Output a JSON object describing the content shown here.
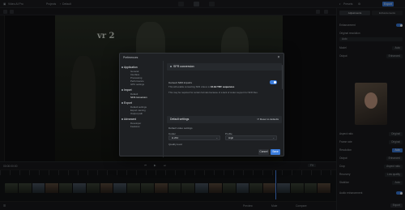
{
  "app": {
    "title": "Video AI Pro",
    "breadcrumb_project": "Projects",
    "breadcrumb_current": "Default"
  },
  "right_header": {
    "presets_label": "Presets",
    "export_label": "Export"
  },
  "right_panel": {
    "tabs": [
      "Adjustments",
      "Enhancements"
    ],
    "rows": [
      {
        "label": "Enhancement",
        "value": ""
      },
      {
        "label": "Original resolution",
        "value": "Auto"
      },
      {
        "label": "Model",
        "value": "Auto"
      },
      {
        "label": "Output",
        "value": "Enhanced"
      }
    ],
    "bottom_rows": [
      {
        "label": "Aspect ratio",
        "value": "Original"
      },
      {
        "label": "Frame rate",
        "value": "Original"
      },
      {
        "label": "Resolution",
        "value": "Auto"
      },
      {
        "label": "Output",
        "value": "Enhanced"
      },
      {
        "label": "Crop",
        "value": "Aspect ratio"
      },
      {
        "label": "Recovery",
        "value": "Low quality"
      },
      {
        "label": "Stabilize",
        "value": "Auto"
      }
    ],
    "audio_label": "Audio enhancement",
    "export_button": "Export"
  },
  "timeline": {
    "duration_label": "00:00:00:00",
    "zoom_label": "Fit",
    "footer_buttons": [
      "Preview",
      "Mute",
      "Compare"
    ]
  },
  "dialog": {
    "title": "Preferences",
    "close_glyph": "×",
    "categories": [
      {
        "label": "Application",
        "subs": [
          "General",
          "Interface",
          "Processing",
          "Performance",
          "GPU settings"
        ]
      },
      {
        "label": "Import",
        "subs": [
          "Default",
          "SFR conversion"
        ]
      },
      {
        "label": "Export",
        "subs": [
          "Default settings",
          "Export naming",
          "Output path"
        ]
      },
      {
        "label": "Advanced",
        "subs": [
          "Developer",
          "Features"
        ]
      }
    ],
    "section_title": "SFR conversion",
    "toggle_label": "Convert SFR imports",
    "note_line_1_prefix": "This will enable converting SFR videos to ",
    "note_line_1_strong": "16-bit TIFF sequences",
    "note_line_2": "This may be required for certain formats because of a lack of codec support for SFR",
    "note_line_3": "files.",
    "default_header": "Default settings",
    "reset_label": "Reset to defaults",
    "default_caption": "Default video settings",
    "codec_label": "Codec",
    "codec_value": "H.264",
    "profile_label": "Profile",
    "profile_value": "High",
    "quality_label": "Quality level",
    "cancel_label": "Cancel",
    "save_label": "Save"
  },
  "colors": {
    "accent": "#3b7ddd",
    "dialog_bg": "#1e2023",
    "app_bg": "#151618"
  },
  "icons": [
    "playback-icon",
    "gear-icon",
    "close-icon",
    "reset-icon",
    "chevron-down-icon"
  ]
}
